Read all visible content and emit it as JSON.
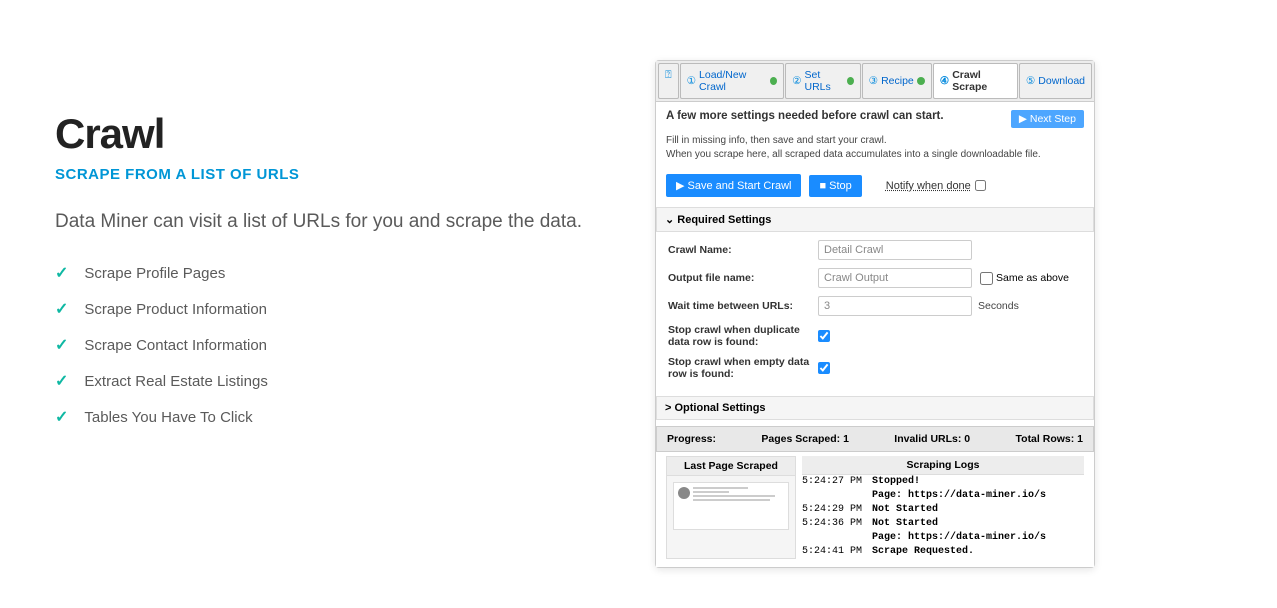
{
  "left": {
    "title": "Crawl",
    "subtitle": "SCRAPE FROM A LIST OF URLS",
    "desc": "Data Miner can visit a list of URLs for you and scrape the data.",
    "features": [
      "Scrape Profile Pages",
      "Scrape Product Information",
      "Scrape Contact Information",
      "Extract Real Estate Listings",
      "Tables You Have To Click"
    ]
  },
  "tabs": {
    "help": "?",
    "items": [
      {
        "num": "①",
        "label": "Load/New Crawl",
        "done": true
      },
      {
        "num": "②",
        "label": "Set URLs",
        "done": true
      },
      {
        "num": "③",
        "label": "Recipe",
        "done": true
      },
      {
        "num": "④",
        "label": "Crawl Scrape",
        "active": true
      },
      {
        "num": "⑤",
        "label": "Download"
      }
    ]
  },
  "body": {
    "heading": "A few more settings needed before crawl can start.",
    "next": "▶ Next Step",
    "info1": "Fill in missing info, then save and start your crawl.",
    "info2": "When you scrape here, all scraped data accumulates into a single downloadable file.",
    "start": "▶ Save and Start Crawl",
    "stop": "■ Stop",
    "notify": "Notify when done"
  },
  "required": {
    "header": "⌄ Required Settings",
    "crawl_name_label": "Crawl Name:",
    "crawl_name_value": "Detail Crawl",
    "output_label": "Output file name:",
    "output_value": "Crawl Output",
    "same_as": "Same as above",
    "wait_label": "Wait time between URLs:",
    "wait_value": "3",
    "seconds": "Seconds",
    "dup_label": "Stop crawl when duplicate data row is found:",
    "empty_label": "Stop crawl when empty data row is found:"
  },
  "optional": {
    "header": "> Optional Settings"
  },
  "progress": {
    "label": "Progress:",
    "pages": "Pages Scraped: 1",
    "invalid": "Invalid URLs: 0",
    "total": "Total Rows: 1"
  },
  "logs": {
    "last_page": "Last Page Scraped",
    "scraping": "Scraping Logs",
    "t1": "5:24:27 PM",
    "m1a": "Stopped!",
    "m1b": "Page: https://data-miner.io/s",
    "t2": "5:24:29 PM",
    "m2": "Not Started",
    "t3": "5:24:36 PM",
    "m3a": "Not Started",
    "m3b": "Page: https://data-miner.io/s",
    "t4": "5:24:41 PM",
    "m4": "Scrape Requested."
  }
}
